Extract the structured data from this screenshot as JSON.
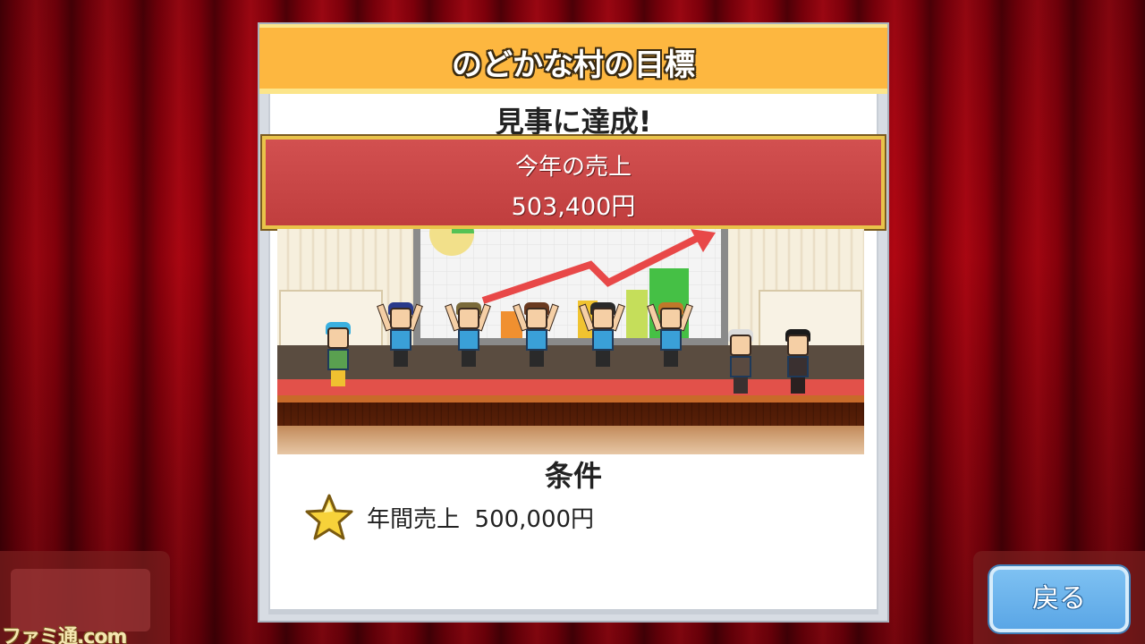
{
  "dialog": {
    "title": "のどかな村の目標",
    "status": "見事に達成!",
    "sales": {
      "label": "今年の売上",
      "value": "503,400円"
    },
    "conditions": {
      "title": "条件",
      "items": [
        {
          "icon": "star-icon",
          "text": "年間売上  500,000円"
        }
      ]
    }
  },
  "buttons": {
    "back_label": "戻る"
  },
  "watermark": "ファミ通.com",
  "colors": {
    "title_bar": "#fdb740",
    "sales_box": "#c84646",
    "back_button": "#6cb4ec",
    "curtain": "#a0000c"
  }
}
